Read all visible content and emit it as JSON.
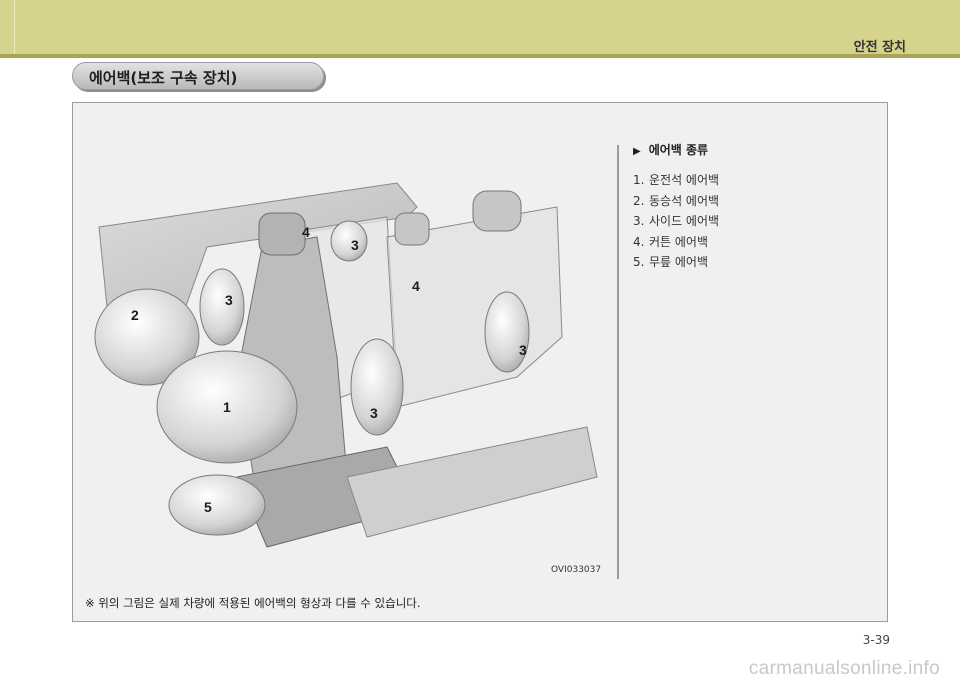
{
  "header": {
    "chapter_title": "안전 장치"
  },
  "section": {
    "title": "에어백(보조 구속 장치)"
  },
  "figure": {
    "code": "OVI033037",
    "callouts": [
      "1",
      "2",
      "3",
      "3",
      "3",
      "3",
      "4",
      "4",
      "5"
    ]
  },
  "legend": {
    "heading": "에어백 종류",
    "items": [
      {
        "num": "1.",
        "label": "운전석 에어백"
      },
      {
        "num": "2.",
        "label": "동승석 에어백"
      },
      {
        "num": "3.",
        "label": "사이드 에어백"
      },
      {
        "num": "4.",
        "label": "커튼 에어백"
      },
      {
        "num": "5.",
        "label": "무릎 에어백"
      }
    ]
  },
  "footnote": "※ 위의 그림은 실제 차량에 적용된 에어백의 형상과 다를 수 있습니다.",
  "page_number": "3-39",
  "watermark": "carmanualsonline.info",
  "colors": {
    "header_band": "#d6d48c",
    "header_rule": "#a8a655",
    "figure_background": "#f0f0f0"
  }
}
